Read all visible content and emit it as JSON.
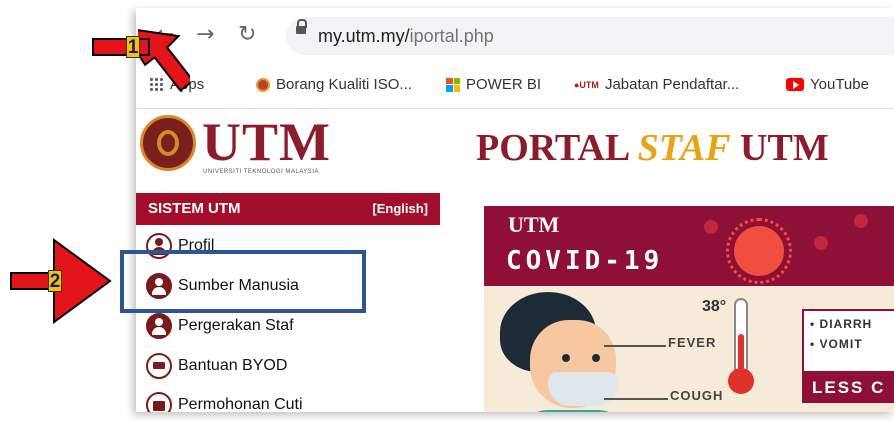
{
  "browser": {
    "back_icon": "arrow-left-icon",
    "forward_icon": "arrow-right-icon",
    "reload_icon": "reload-icon",
    "url_host": "my.utm.my/",
    "url_path": "iportal.php",
    "bookmarks": [
      {
        "label": "Apps",
        "icon": "apps-grid-icon"
      },
      {
        "label": "Borang Kualiti ISO...",
        "icon": "iso-logo-icon"
      },
      {
        "label": "POWER BI",
        "icon": "microsoft-icon"
      },
      {
        "label": "Jabatan Pendaftar...",
        "icon": "utm-small-icon"
      },
      {
        "label": "YouTube",
        "icon": "youtube-icon"
      }
    ]
  },
  "header": {
    "logo_text": "UTM",
    "logo_subtext": "UNIVERSITI TEKNOLOGI MALAYSIA",
    "title_part1": "PORTAL ",
    "title_part2": "STAF",
    "title_part3": " UTM"
  },
  "sidebar": {
    "heading": "SISTEM UTM",
    "language_link": "[English]",
    "items": [
      {
        "label": "Profil",
        "icon": "user-icon"
      },
      {
        "label": "Sumber Manusia",
        "icon": "people-icon"
      },
      {
        "label": "Pergerakan Staf",
        "icon": "people-icon"
      },
      {
        "label": "Bantuan BYOD",
        "icon": "laptop-icon"
      },
      {
        "label": "Permohonan Cuti",
        "icon": "calendar-icon"
      }
    ]
  },
  "banner": {
    "utm_label": "UTM",
    "covid_label": "COVID-19",
    "temperature": "38°",
    "fever_label": "FEVER",
    "cough_label": "COUGH",
    "symptoms": [
      "• DIARRH",
      "• VOMIT"
    ],
    "less_label": "LESS C"
  },
  "annotations": {
    "marker_1": "1",
    "marker_2": "2"
  },
  "colors": {
    "utm_maroon": "#8b1c2a",
    "sidebar_red": "#a30f2b",
    "highlight_blue": "#2f5496",
    "arrow_red": "#e3151a",
    "marker_yellow": "#f5c400",
    "staf_gold": "#e8a317"
  }
}
